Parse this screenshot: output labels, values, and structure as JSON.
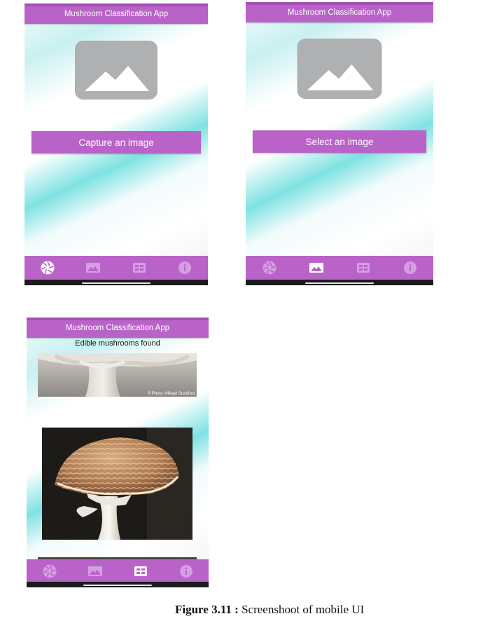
{
  "app_title": "Mushroom Classification App",
  "screens": {
    "capture": {
      "button_label": "Capture an image",
      "active_tab": "camera"
    },
    "select": {
      "button_label": "Select an image",
      "active_tab": "gallery"
    },
    "gallery": {
      "heading": "Edible mushrooms found",
      "photo_credit": "© Photo: Mikael Sundfors",
      "active_tab": "grid"
    }
  },
  "nav_items": [
    "camera-icon",
    "image-icon",
    "grid-icon",
    "info-icon"
  ],
  "colors": {
    "accent": "#b963c8",
    "placeholder": "#aeb0b1",
    "gradient_teal": "#7fe2e2"
  },
  "caption": {
    "figure_label": "Figure 3.11 :",
    "text": "Screenshoot of mobile UI"
  }
}
